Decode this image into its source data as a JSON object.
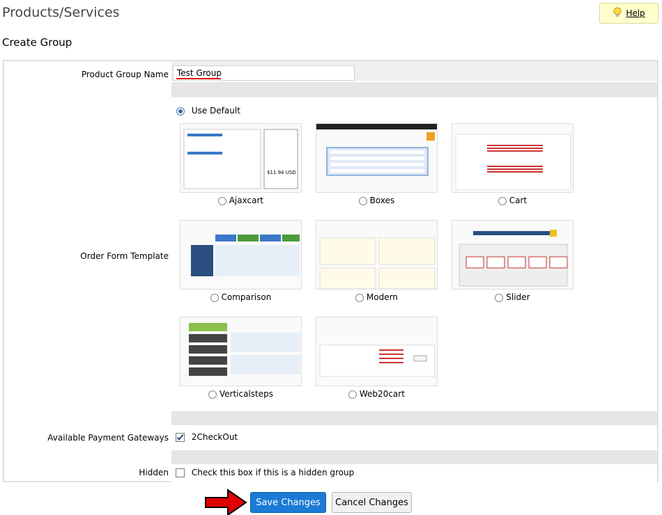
{
  "header": {
    "title": "Products/Services",
    "help_label": "Help"
  },
  "section_title": "Create Group",
  "form": {
    "group_name_label": "Product Group Name",
    "group_name_value": "Test Group",
    "order_form_label": "Order Form Template",
    "use_default_label": "Use Default",
    "templates": [
      {
        "name": "Ajaxcart"
      },
      {
        "name": "Boxes"
      },
      {
        "name": "Cart"
      },
      {
        "name": "Comparison"
      },
      {
        "name": "Modern"
      },
      {
        "name": "Slider"
      },
      {
        "name": "Verticalsteps"
      },
      {
        "name": "Web20cart"
      }
    ],
    "payment_label": "Available Payment Gateways",
    "payment_option": "2CheckOut",
    "hidden_label": "Hidden",
    "hidden_text": "Check this box if this is a hidden group"
  },
  "buttons": {
    "save": "Save Changes",
    "cancel": "Cancel Changes"
  },
  "colors": {
    "accent": "#1a7bd6",
    "help_bg": "#ffffcc",
    "pointer_arrow": "#e00000"
  }
}
